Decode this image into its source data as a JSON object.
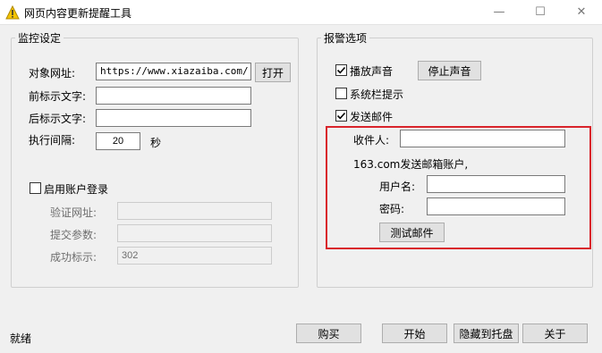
{
  "window": {
    "title": "网页内容更新提醒工具",
    "minimize": "—",
    "maximize": "☐",
    "close": "✕"
  },
  "monitor": {
    "legend": "监控设定",
    "target_url_label": "对象网址:",
    "target_url_value": "https://www.xiazaiba.com/",
    "open_button": "打开",
    "prefix_label": "前标示文字:",
    "prefix_value": "",
    "suffix_label": "后标示文字:",
    "suffix_value": "",
    "interval_label": "执行间隔:",
    "interval_value": "20",
    "interval_unit": "秒",
    "login_checkbox_label": "启用账户登录",
    "login_checked": false,
    "verify_url_label": "验证网址:",
    "verify_url_value": "",
    "submit_params_label": "提交参数:",
    "submit_params_value": "",
    "success_label": "成功标示:",
    "success_value": "302"
  },
  "alarm": {
    "legend": "报警选项",
    "play_sound_label": "播放声音",
    "play_sound_checked": true,
    "stop_sound_button": "停止声音",
    "tray_tip_label": "系统栏提示",
    "tray_tip_checked": false,
    "send_mail_label": "发送邮件",
    "send_mail_checked": true,
    "recipient_label": "收件人:",
    "recipient_value": "",
    "sender_account_label": "163.com发送邮箱账户,",
    "username_label": "用户名:",
    "username_value": "",
    "password_label": "密码:",
    "password_value": "",
    "test_mail_button": "测试邮件",
    "highlight_color": "#d9232b"
  },
  "footer": {
    "status": "就绪",
    "buy_button": "购买",
    "start_button": "开始",
    "hide_tray_button": "隐藏到托盘",
    "about_button": "关于"
  }
}
